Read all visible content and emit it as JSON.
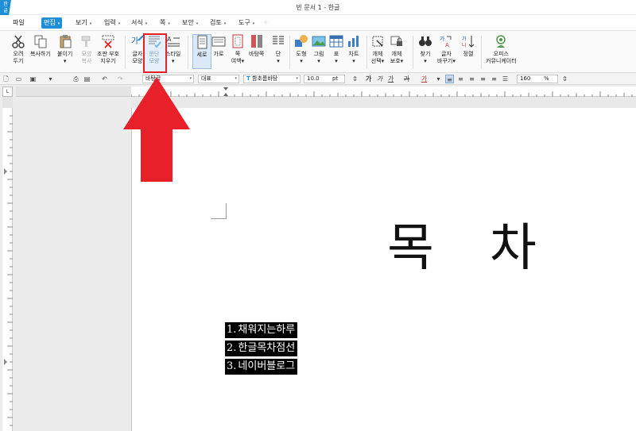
{
  "titlebar": {
    "app_icon": "hangul-app-icon",
    "title": "빈 문서 1 - 한글"
  },
  "menu": {
    "items": [
      {
        "label": "파일",
        "has_arrow": false
      },
      {
        "label": "편집",
        "has_arrow": true,
        "active": true
      },
      {
        "label": "보기",
        "has_arrow": true
      },
      {
        "label": "입력",
        "has_arrow": true
      },
      {
        "label": "서식",
        "has_arrow": true
      },
      {
        "label": "쪽",
        "has_arrow": true
      },
      {
        "label": "보안",
        "has_arrow": true
      },
      {
        "label": "검토",
        "has_arrow": true
      },
      {
        "label": "도구",
        "has_arrow": true
      }
    ],
    "arrow_glyph": "▾"
  },
  "ribbon": {
    "cut": [
      "오려",
      "두기"
    ],
    "copy": [
      "복사하기",
      ""
    ],
    "paste": [
      "붙이기",
      "▾"
    ],
    "format_copy": [
      "모양",
      "복사"
    ],
    "clear_format": [
      "조판 부호",
      "지우기"
    ],
    "char_shape": [
      "글자",
      "모양"
    ],
    "para_shape": [
      "문단",
      "모양"
    ],
    "style": [
      "스타일",
      "▾"
    ],
    "vertical": [
      "세로",
      ""
    ],
    "horizontal": [
      "가로",
      ""
    ],
    "page_margin": [
      "쪽",
      "여백▾"
    ],
    "page_bg": [
      "바탕쪽",
      ""
    ],
    "columns": [
      "단",
      "▾"
    ],
    "shape": [
      "도형",
      "▾"
    ],
    "picture": [
      "그림",
      "▾"
    ],
    "table": [
      "표",
      "▾"
    ],
    "chart": [
      "차트",
      "▾"
    ],
    "object_select": [
      "개체",
      "선택▾"
    ],
    "object_protect": [
      "개체",
      "보호▾"
    ],
    "find": [
      "찾기",
      "▾"
    ],
    "replace_char": [
      "글자",
      "바꾸기▾"
    ],
    "sort": [
      "정렬",
      ""
    ],
    "office_connector": [
      "오피스",
      "커뮤니케이터"
    ]
  },
  "toolbar2": {
    "style_value": "바탕글",
    "lang_value": "대표",
    "font_value": "함초롬바탕",
    "font_icon": "T",
    "size_value": "10.0",
    "size_unit": "pt",
    "zoom_value": "160",
    "zoom_unit": "%",
    "bold": "가",
    "italic": "가",
    "underline": "가",
    "strike": "가"
  },
  "document": {
    "heading_left": "목",
    "heading_right": "차",
    "toc": [
      {
        "num": "1.",
        "text": "채워지는하루"
      },
      {
        "num": "2.",
        "text": "한글목차점선"
      },
      {
        "num": "3.",
        "text": "네이버블로그"
      }
    ]
  },
  "annotation": {
    "color": "#e8202a"
  }
}
